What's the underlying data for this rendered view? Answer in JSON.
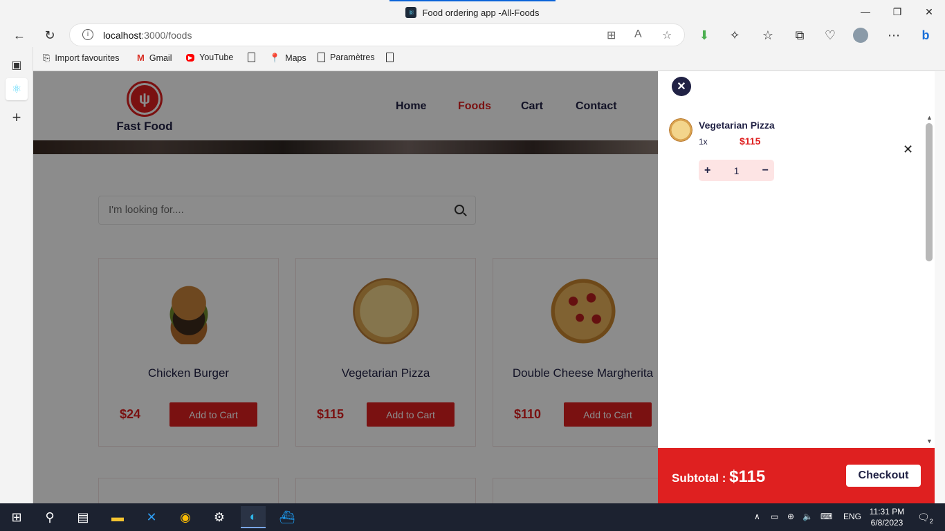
{
  "browser": {
    "tab_title": "Food ordering app -All-Foods",
    "url_host": "localhost",
    "url_rest": ":3000/foods",
    "favourites": [
      {
        "label": "Import favourites"
      },
      {
        "label": "Gmail"
      },
      {
        "label": "YouTube"
      },
      {
        "label": ""
      },
      {
        "label": "Maps"
      },
      {
        "label": "Paramètres"
      },
      {
        "label": ""
      }
    ]
  },
  "site": {
    "logo_text": "Fast Food",
    "nav": [
      {
        "label": "Home",
        "active": false
      },
      {
        "label": "Foods",
        "active": true
      },
      {
        "label": "Cart",
        "active": false
      },
      {
        "label": "Contact",
        "active": false
      }
    ],
    "search_placeholder": "I'm looking for....",
    "products": [
      {
        "title": "Chicken Burger",
        "price": "$24",
        "button": "Add to Cart",
        "image": "burger"
      },
      {
        "title": "Vegetarian Pizza",
        "price": "$115",
        "button": "Add to Cart",
        "image": "pizza-veg"
      },
      {
        "title": "Double Cheese Margherita",
        "price": "$110",
        "button": "Add to Cart",
        "image": "pizza-pep"
      }
    ]
  },
  "cart": {
    "items": [
      {
        "name": "Vegetarian Pizza",
        "qty_label": "1x",
        "price": "$115",
        "quantity": "1"
      }
    ],
    "subtotal_label": "Subtotal :",
    "subtotal_value": "$115",
    "checkout_label": "Checkout"
  },
  "taskbar": {
    "language": "ENG",
    "time": "11:31 PM",
    "date": "6/8/2023",
    "notification_count": "2"
  },
  "colors": {
    "accent_red": "#df2020",
    "navy": "#212245"
  }
}
